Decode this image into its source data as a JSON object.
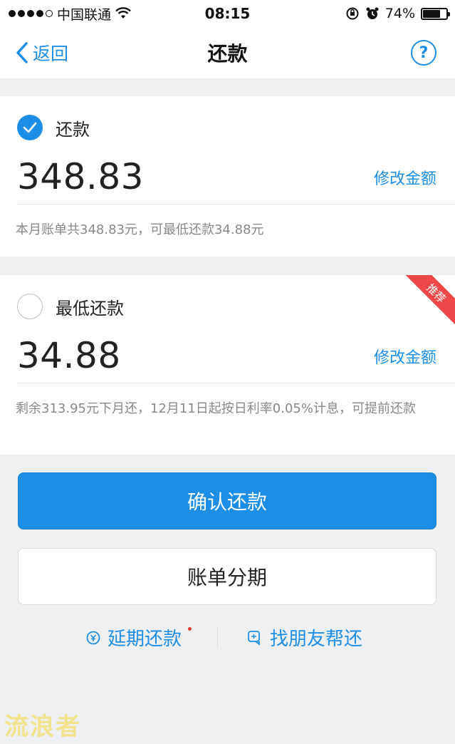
{
  "status_bar": {
    "carrier": "中国联通",
    "time": "08:15",
    "battery_percent": "74%",
    "battery_level": 0.74,
    "icons": [
      "signal-dots",
      "wifi-icon",
      "rotation-lock-icon",
      "alarm-icon",
      "battery-icon"
    ]
  },
  "nav": {
    "back_label": "返回",
    "title": "还款",
    "help_label": "?"
  },
  "full_payment": {
    "label": "还款",
    "selected": true,
    "amount": "348.83",
    "edit_label": "修改金额",
    "note": "本月账单共348.83元，可最低还款34.88元"
  },
  "min_payment": {
    "label": "最低还款",
    "selected": false,
    "amount": "34.88",
    "edit_label": "修改金额",
    "badge": "推荐",
    "note": "剩余313.95元下月还，12月11日起按日利率0.05%计息，可提前还款"
  },
  "actions": {
    "confirm_label": "确认还款",
    "installment_label": "账单分期"
  },
  "links": {
    "extend_label": "延期还款",
    "friend_label": "找朋友帮还"
  },
  "watermark": "流浪者",
  "colors": {
    "accent": "#1d8ee8",
    "badge": "#f04848",
    "background": "#eff0f4"
  }
}
